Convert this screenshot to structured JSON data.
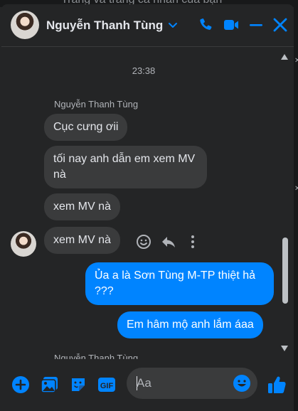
{
  "background": {
    "partial_text": "Trang và trang cá nhân của bạn"
  },
  "header": {
    "name": "Nguyễn Thanh Tùng"
  },
  "colors": {
    "accent": "#0084ff",
    "panel": "#242526",
    "bubble_in": "#3a3b3c"
  },
  "conversation": {
    "timestamp": "23:38",
    "sender_label": "Nguyễn Thanh Tùng",
    "incoming": [
      {
        "text": "Cục cưng ơii"
      },
      {
        "text": "tối nay anh dẫn em xem MV nà"
      },
      {
        "text": "xem MV nà"
      },
      {
        "text": "xem MV nà"
      }
    ],
    "outgoing": [
      {
        "text": "Ủa a là Sơn Tùng M-TP thiệt hả ???"
      },
      {
        "text": "Em hâm mộ anh lắm áaa"
      }
    ],
    "clipped_label": "Nguyễn Thanh Tùng"
  },
  "composer": {
    "placeholder": "Aa",
    "gif_label": "GIF"
  },
  "icons": [
    "chevron-down-icon",
    "phone-icon",
    "video-icon",
    "minimize-icon",
    "close-icon",
    "emoji-react-icon",
    "reply-icon",
    "more-icon",
    "plus-icon",
    "image-icon",
    "sticker-icon",
    "gif-icon",
    "emoji-icon",
    "like-icon"
  ]
}
